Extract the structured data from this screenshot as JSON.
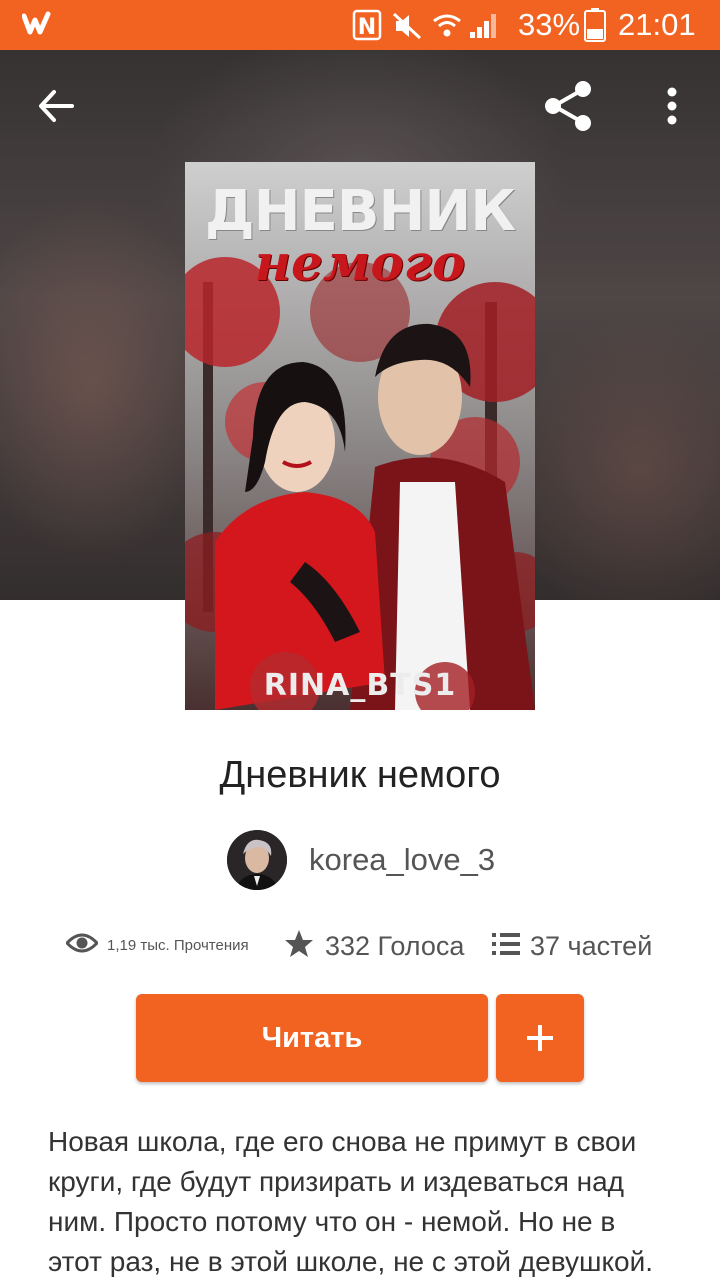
{
  "status_bar": {
    "battery_percent": "33%",
    "time": "21:01",
    "icons": [
      "wattpad-logo-icon",
      "nfc-icon",
      "mute-icon",
      "wifi-icon",
      "signal-icon",
      "battery-icon"
    ]
  },
  "toolbar": {
    "icons": [
      "back-arrow-icon",
      "share-icon",
      "more-vertical-icon"
    ]
  },
  "cover": {
    "title": "ДНЕВНИК",
    "subtitle": "немого",
    "author_tag": "RINA_BTS1"
  },
  "story": {
    "title": "Дневник немого",
    "author": "korea_love_3"
  },
  "stats": {
    "reads": "1,19 тыс. Прочтения",
    "votes": "332 Голоса",
    "parts": "37 частей"
  },
  "actions": {
    "read_label": "Читать",
    "add_icon": "plus-icon"
  },
  "description": {
    "lines": [
      "Новая школа, где его снова не примут в свои",
      "круги, где будут призирать и издеваться над",
      "ним. Просто потому что он - немой. Но не в",
      "этот раз, не в этой школе, не с этой девушкой."
    ]
  },
  "colors": {
    "accent": "#f26322",
    "title_text": "#222222",
    "secondary_text": "#555555"
  }
}
